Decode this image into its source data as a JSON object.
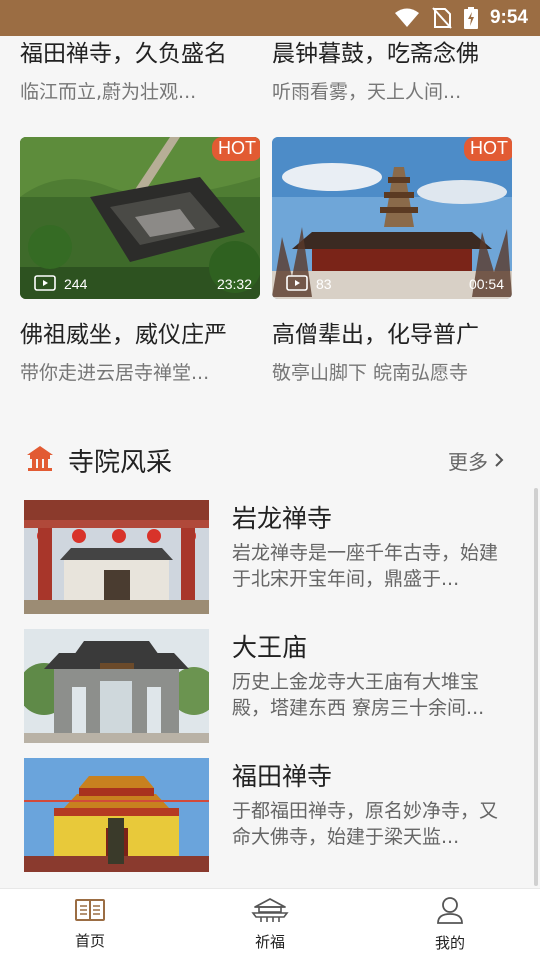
{
  "status_bar": {
    "time": "9:54"
  },
  "videos": [
    {
      "title": "福田禅寺，久负盛名",
      "subtitle": "临江而立,蔚为壮观..."
    },
    {
      "title": "晨钟暮鼓，吃斋念佛",
      "subtitle": "听雨看雾，天上人间..."
    },
    {
      "title": "佛祖威坐，威仪庄严",
      "subtitle": "带你走进云居寺禅堂...",
      "badge": "HOT",
      "views": "244",
      "duration": "23:32"
    },
    {
      "title": "高僧辈出，化导普广",
      "subtitle": "敬亭山脚下 皖南弘愿寺",
      "badge": "HOT",
      "views": "83",
      "duration": "00:54"
    }
  ],
  "section": {
    "title": "寺院风采",
    "more": "更多",
    "icon": "temple-icon",
    "accent": "#e25b33"
  },
  "temples": [
    {
      "name": "岩龙禅寺",
      "desc": "岩龙禅寺是一座千年古寺，始建于北宋开宝年间，鼎盛于..."
    },
    {
      "name": "大王庙",
      "desc": "历史上金龙寺大王庙有大堆宝殿，塔建东西 寮房三十余间..."
    },
    {
      "name": "福田禅寺",
      "desc": "于都福田禅寺，原名妙净寺，又命大佛寺，始建于梁天监..."
    }
  ],
  "tabs": [
    {
      "label": "首页",
      "icon": "book-icon"
    },
    {
      "label": "祈福",
      "icon": "pray-temple-icon"
    },
    {
      "label": "我的",
      "icon": "user-icon"
    }
  ],
  "colors": {
    "status_bar": "#9b6d43",
    "hot_badge": "#e25b33"
  }
}
